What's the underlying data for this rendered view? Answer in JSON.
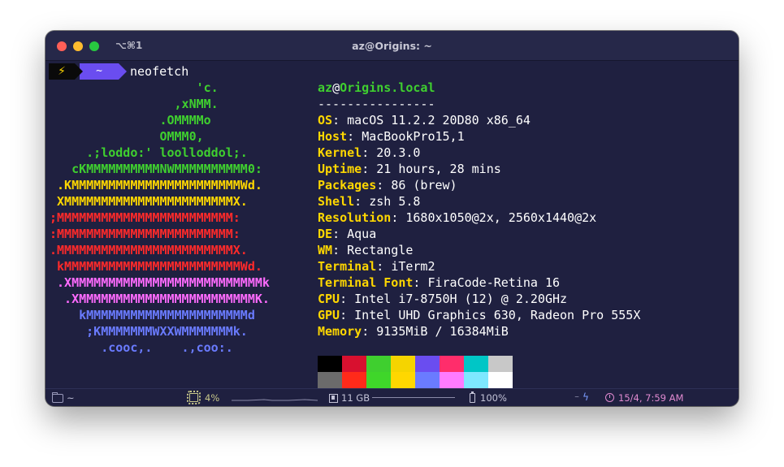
{
  "window": {
    "shortcut": "⌥⌘1",
    "title": "az@Origins: ~"
  },
  "prompt": {
    "segment1_icon": "⚡",
    "segment2_dir": "~",
    "command": "neofetch"
  },
  "logo": {
    "lines": [
      {
        "text": "                    'c.",
        "color": "#3fcf2f"
      },
      {
        "text": "                 ,xNMM.",
        "color": "#3fcf2f"
      },
      {
        "text": "               .OMMMMo",
        "color": "#3fcf2f"
      },
      {
        "text": "               OMMM0,",
        "color": "#3fcf2f"
      },
      {
        "text": "     .;loddo:' loolloddol;.",
        "color": "#3fcf2f"
      },
      {
        "text": "   cKMMMMMMMMMMNWMMMMMMMMMM0:",
        "color": "#3fcf2f"
      },
      {
        "text": " .KMMMMMMMMMMMMMMMMMMMMMMMWd.",
        "color": "#ffd700"
      },
      {
        "text": " XMMMMMMMMMMMMMMMMMMMMMMMX.",
        "color": "#ffd700"
      },
      {
        "text": ";MMMMMMMMMMMMMMMMMMMMMMMM:",
        "color": "#ff2a2a"
      },
      {
        "text": ":MMMMMMMMMMMMMMMMMMMMMMMM:",
        "color": "#ff2a2a"
      },
      {
        "text": ".MMMMMMMMMMMMMMMMMMMMMMMMX.",
        "color": "#ff2a2a"
      },
      {
        "text": " kMMMMMMMMMMMMMMMMMMMMMMMMWd.",
        "color": "#ff2a2a"
      },
      {
        "text": " .XMMMMMMMMMMMMMMMMMMMMMMMMMMk",
        "color": "#ff6bff"
      },
      {
        "text": "  .XMMMMMMMMMMMMMMMMMMMMMMMMK.",
        "color": "#ff6bff"
      },
      {
        "text": "    kMMMMMMMMMMMMMMMMMMMMMMd",
        "color": "#6a7bff"
      },
      {
        "text": "     ;KMMMMMMMWXXWMMMMMMMk.",
        "color": "#6a7bff"
      },
      {
        "text": "       .cooc,.    .,coo:.",
        "color": "#6a7bff"
      }
    ]
  },
  "info": {
    "user": "az",
    "at": "@",
    "host": "Origins.local",
    "separator": "----------------",
    "rows": [
      {
        "key": "OS",
        "value": "macOS 11.2.2 20D80 x86_64"
      },
      {
        "key": "Host",
        "value": "MacBookPro15,1"
      },
      {
        "key": "Kernel",
        "value": "20.3.0"
      },
      {
        "key": "Uptime",
        "value": "21 hours, 28 mins"
      },
      {
        "key": "Packages",
        "value": "86 (brew)"
      },
      {
        "key": "Shell",
        "value": "zsh 5.8"
      },
      {
        "key": "Resolution",
        "value": "1680x1050@2x, 2560x1440@2x"
      },
      {
        "key": "DE",
        "value": "Aqua"
      },
      {
        "key": "WM",
        "value": "Rectangle"
      },
      {
        "key": "Terminal",
        "value": "iTerm2"
      },
      {
        "key": "Terminal Font",
        "value": "FiraCode-Retina 16"
      },
      {
        "key": "CPU",
        "value": "Intel i7-8750H (12) @ 2.20GHz"
      },
      {
        "key": "GPU",
        "value": "Intel UHD Graphics 630, Radeon Pro 555X"
      },
      {
        "key": "Memory",
        "value": "9135MiB / 16384MiB"
      }
    ]
  },
  "swatches": {
    "row1": [
      "#000000",
      "#d8102f",
      "#3fcf2f",
      "#f5d400",
      "#6a4df0",
      "#ff2d6b",
      "#00c6c6",
      "#c8c8c8"
    ],
    "row2": [
      "#6b6b6b",
      "#ff2a1a",
      "#3fd62a",
      "#ffd700",
      "#6a7bff",
      "#ff7bff",
      "#7ee8ff",
      "#ffffff"
    ]
  },
  "statusbar": {
    "dir": "~",
    "cpu": "4%",
    "memory": "11 GB",
    "battery": "100%",
    "power_text": "⁻",
    "clock": "15/4, 7:59 AM"
  }
}
